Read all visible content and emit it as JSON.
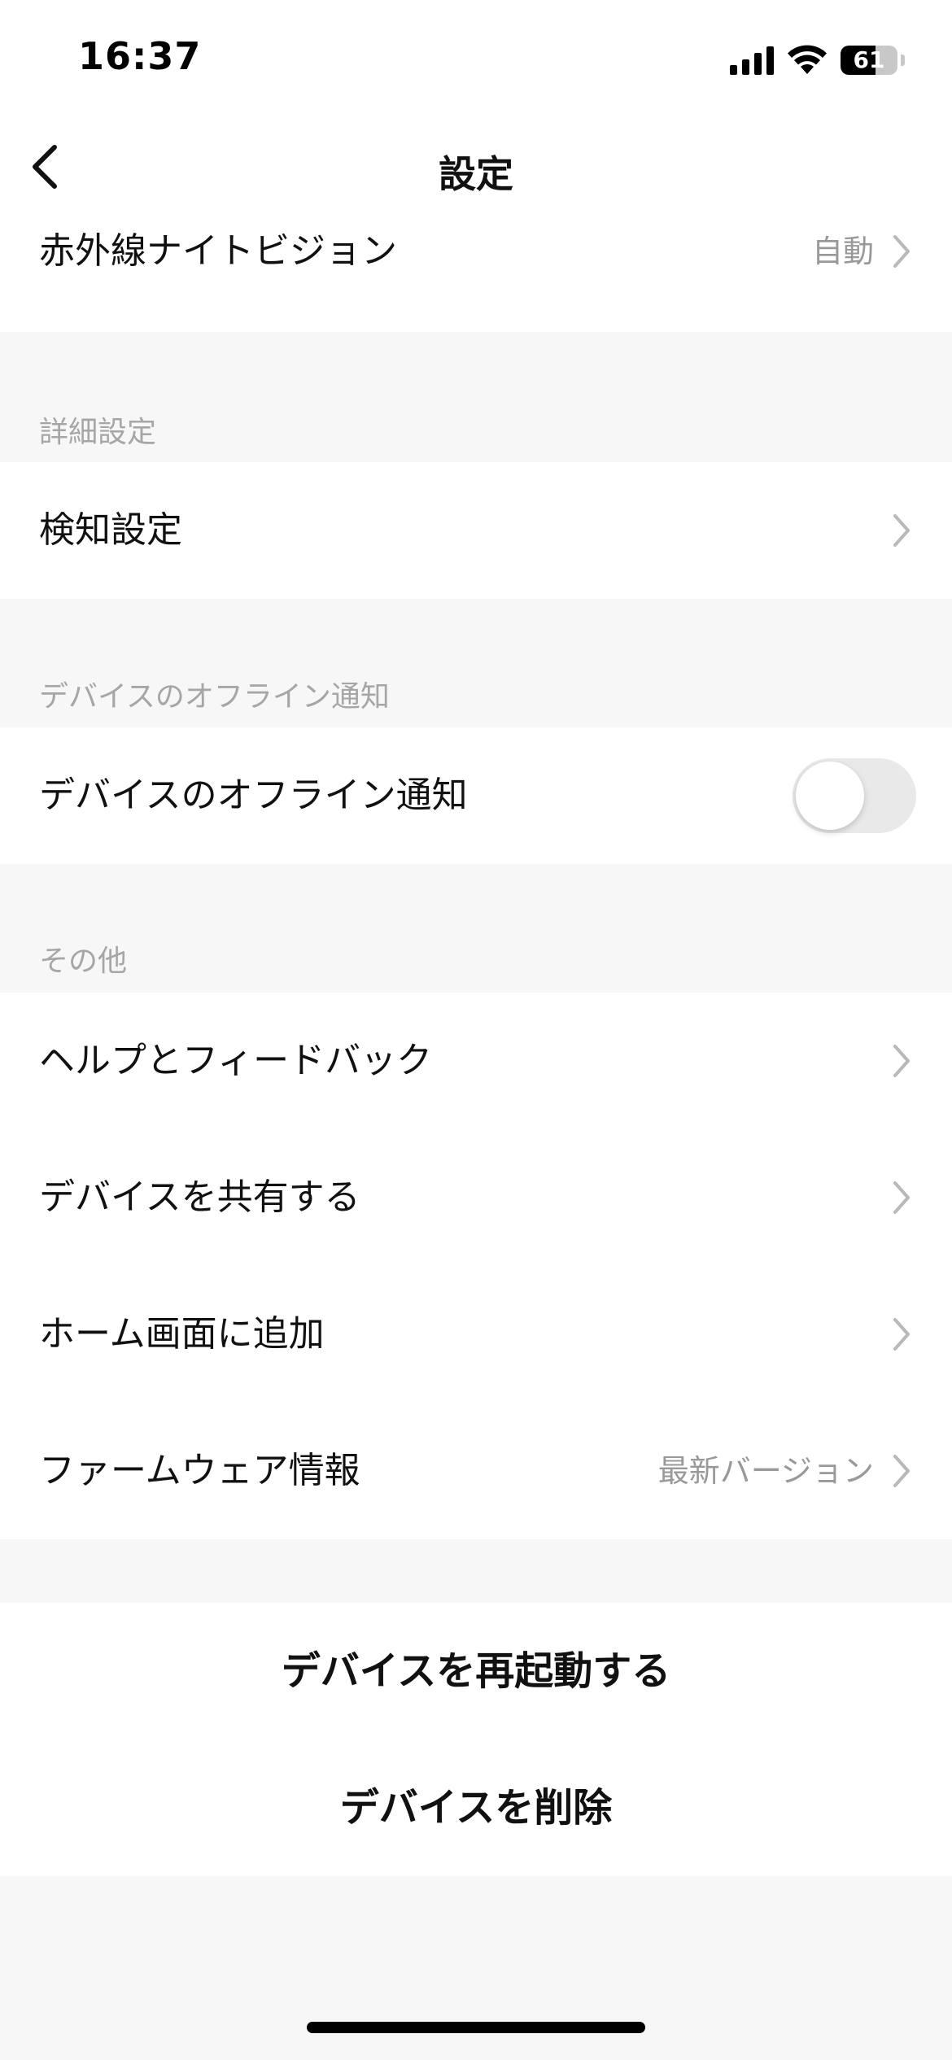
{
  "status_bar": {
    "time": "16:37",
    "battery_level": "61",
    "signal_icon": "cellular-signal-icon",
    "wifi_icon": "wifi-icon"
  },
  "nav": {
    "title": "設定",
    "back_icon": "chevron-left-icon"
  },
  "rows": {
    "night_vision": {
      "label": "赤外線ナイトビジョン",
      "value": "自動"
    },
    "detection": {
      "label": "検知設定"
    },
    "offline_notify": {
      "label": "デバイスのオフライン通知",
      "enabled": false
    },
    "help": {
      "label": "ヘルプとフィードバック"
    },
    "share": {
      "label": "デバイスを共有する"
    },
    "home_screen": {
      "label": "ホーム画面に追加"
    },
    "firmware": {
      "label": "ファームウェア情報",
      "value": "最新バージョン"
    }
  },
  "sections": {
    "advanced": "詳細設定",
    "offline": "デバイスのオフライン通知",
    "other": "その他"
  },
  "actions": {
    "restart": "デバイスを再起動する",
    "remove": "デバイスを削除"
  },
  "colors": {
    "background": "#f7f7f7",
    "row": "#ffffff",
    "secondary_text": "#999999",
    "section_text": "#a6a6a6",
    "toggle_off": "#e9e9ea"
  }
}
